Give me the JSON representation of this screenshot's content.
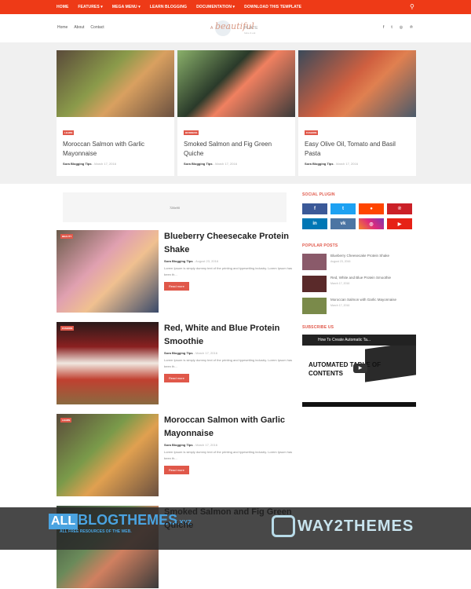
{
  "topnav": {
    "items": [
      "HOME",
      "FEATURES ▾",
      "MEGA MENU ▾",
      "LEARN BLOGGING",
      "DOCUMENTATION ▾",
      "DOWNLOAD THIS TEMPLATE"
    ],
    "search_icon": "search-icon"
  },
  "header": {
    "links": [
      "Home",
      "About",
      "Contact"
    ],
    "logo": {
      "a": "A",
      "beautiful": "beautiful",
      "plate": "PLATE",
      "sub": "bake & eat"
    },
    "social": [
      "f",
      "t",
      "◎",
      "℗"
    ]
  },
  "featured": [
    {
      "tag": "LEARN",
      "title": "Moroccan Salmon with Garlic Mayonnaise",
      "author": "Sora Blogging Tips",
      "date": "- March 17, 2016",
      "color": "#7a8a4a"
    },
    {
      "tag": "BUSINESS",
      "title": "Smoked Salmon and Fig Green Quiche",
      "author": "Sora Blogging Tips",
      "date": "- March 17, 2016",
      "color": "#6d8a5a"
    },
    {
      "tag": "FASHION",
      "title": "Easy Olive Oil, Tomato and Basil Pasta",
      "author": "Sora Blogging Tips",
      "date": "- March 17, 2016",
      "color": "#4a5a6a"
    }
  ],
  "ad": {
    "label": "728x90"
  },
  "posts": [
    {
      "tag": "BEAUTY",
      "title": "Blueberry Cheesecake Protein Shake",
      "author": "Sora Blogging Tips",
      "date": "- August 23, 2016",
      "snippet": "Lorem Ipsum is simply dummy text of the printing and typesetting industry. Lorem Ipsum has been th...",
      "more": "Read more",
      "color": "#b07080"
    },
    {
      "tag": "FASHION",
      "title": "Red, White and Blue Protein Smoothie",
      "author": "Sora Blogging Tips",
      "date": "- March 17, 2016",
      "snippet": "Lorem Ipsum is simply dummy text of the printing and typesetting industry. Lorem Ipsum has been th...",
      "more": "Read more",
      "color": "#5a2a2a"
    },
    {
      "tag": "LEARN",
      "title": "Moroccan Salmon with Garlic Mayonnaise",
      "author": "Sora Blogging Tips",
      "date": "- March 17, 2016",
      "snippet": "Lorem Ipsum is simply dummy text of the printing and typesetting industry. Lorem Ipsum has been th...",
      "more": "Read more",
      "color": "#7a8a4a"
    },
    {
      "title": "Smoked Salmon and Fig Green Quiche"
    }
  ],
  "sidebar": {
    "social_heading": "SOCIAL PLUGIN",
    "social_buttons": [
      {
        "icon": "f",
        "name": "facebook",
        "color": "#3b5998"
      },
      {
        "icon": "t",
        "name": "twitter",
        "color": "#1da1f2"
      },
      {
        "icon": "●",
        "name": "reddit",
        "color": "#ff4500"
      },
      {
        "icon": "℗",
        "name": "pinterest",
        "color": "#cb2027"
      },
      {
        "icon": "in",
        "name": "linkedin",
        "color": "#0077b5"
      },
      {
        "icon": "vk",
        "name": "vk",
        "color": "#4c75a3"
      },
      {
        "icon": "◎",
        "name": "instagram",
        "color": "#c13584"
      },
      {
        "icon": "▶",
        "name": "youtube",
        "color": "#e62117"
      }
    ],
    "popular_heading": "POPULAR POSTS",
    "popular": [
      {
        "title": "Blueberry Cheesecake Protein Shake",
        "date": "August 23, 2016",
        "color": "#8a5a6a"
      },
      {
        "title": "Red, White and Blue Protein Smoothie",
        "date": "March 17, 2016",
        "color": "#5a2a2a"
      },
      {
        "title": "Moroccan Salmon with Garlic Mayonnaise",
        "date": "March 17, 2016",
        "color": "#7a8a4a"
      }
    ],
    "subscribe_heading": "SUBSCRIBE US",
    "video": {
      "title": "How To Create Automatic Ta...",
      "big": "AUTOMATED TABLE OF CONTENTS"
    }
  },
  "watermark": {
    "all": "ALL",
    "blogthemes": "BLOGTHEMES",
    "xyz": ".XYZ",
    "tagline": "ALL FREE RESOURCES OF THE WEB.",
    "way2": "WAY2THEMES"
  }
}
